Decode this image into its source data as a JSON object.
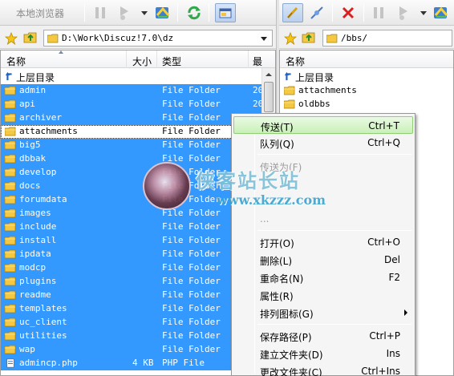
{
  "left_toolbar": {
    "local_browser_label": "本地浏览器"
  },
  "left_path": "D:\\Work\\Discuz!7.0\\dz",
  "right_path": "/bbs/",
  "columns": {
    "name": "名称",
    "size": "大小",
    "type": "类型",
    "date": "最"
  },
  "up_dir_label": "上层目录",
  "left_files": [
    {
      "name": "admin",
      "size": "",
      "type": "File Folder",
      "date": "20",
      "selected": true,
      "kind": "folder"
    },
    {
      "name": "api",
      "size": "",
      "type": "File Folder",
      "date": "20",
      "selected": true,
      "kind": "folder"
    },
    {
      "name": "archiver",
      "size": "",
      "type": "File Folder",
      "date": "",
      "selected": true,
      "kind": "folder"
    },
    {
      "name": "attachments",
      "size": "",
      "type": "File Folder",
      "date": "",
      "selected": false,
      "kind": "folder"
    },
    {
      "name": "big5",
      "size": "",
      "type": "File Folder",
      "date": "",
      "selected": true,
      "kind": "folder"
    },
    {
      "name": "dbbak",
      "size": "",
      "type": "File Folder",
      "date": "",
      "selected": true,
      "kind": "folder"
    },
    {
      "name": "develop",
      "size": "",
      "type": "File Folder",
      "date": "",
      "selected": true,
      "kind": "folder"
    },
    {
      "name": "docs",
      "size": "",
      "type": "File Folder",
      "date": "",
      "selected": true,
      "kind": "folder"
    },
    {
      "name": "forumdata",
      "size": "",
      "type": "File Folder",
      "date": "",
      "selected": true,
      "kind": "folder"
    },
    {
      "name": "images",
      "size": "",
      "type": "File Folder",
      "date": "",
      "selected": true,
      "kind": "folder"
    },
    {
      "name": "include",
      "size": "",
      "type": "File Folder",
      "date": "",
      "selected": true,
      "kind": "folder"
    },
    {
      "name": "install",
      "size": "",
      "type": "File Folder",
      "date": "",
      "selected": true,
      "kind": "folder"
    },
    {
      "name": "ipdata",
      "size": "",
      "type": "File Folder",
      "date": "",
      "selected": true,
      "kind": "folder"
    },
    {
      "name": "modcp",
      "size": "",
      "type": "File Folder",
      "date": "",
      "selected": true,
      "kind": "folder"
    },
    {
      "name": "plugins",
      "size": "",
      "type": "File Folder",
      "date": "",
      "selected": true,
      "kind": "folder"
    },
    {
      "name": "readme",
      "size": "",
      "type": "File Folder",
      "date": "",
      "selected": true,
      "kind": "folder"
    },
    {
      "name": "templates",
      "size": "",
      "type": "File Folder",
      "date": "",
      "selected": true,
      "kind": "folder"
    },
    {
      "name": "uc_client",
      "size": "",
      "type": "File Folder",
      "date": "",
      "selected": true,
      "kind": "folder"
    },
    {
      "name": "utilities",
      "size": "",
      "type": "File Folder",
      "date": "",
      "selected": true,
      "kind": "folder"
    },
    {
      "name": "wap",
      "size": "",
      "type": "File Folder",
      "date": "",
      "selected": true,
      "kind": "folder"
    },
    {
      "name": "admincp.php",
      "size": "4 KB",
      "type": "PHP File",
      "date": "",
      "selected": true,
      "kind": "file"
    }
  ],
  "right_files": [
    {
      "name": "attachments",
      "kind": "folder"
    },
    {
      "name": "oldbbs",
      "kind": "folder"
    }
  ],
  "context_menu": [
    {
      "label": "传送(T)",
      "shortcut": "Ctrl+T",
      "state": "highlighted"
    },
    {
      "label": "队列(Q)",
      "shortcut": "Ctrl+Q",
      "state": "normal"
    },
    {
      "sep": true
    },
    {
      "label": "传送为(F)",
      "shortcut": "",
      "state": "disabled"
    },
    {
      "label": "",
      "shortcut": "",
      "state": "obscured"
    },
    {
      "label": "",
      "shortcut": "",
      "state": "obscured"
    },
    {
      "label": "...",
      "shortcut": "",
      "state": "obscured"
    },
    {
      "sep": true
    },
    {
      "label": "打开(O)",
      "shortcut": "Ctrl+O",
      "state": "normal"
    },
    {
      "label": "删除(L)",
      "shortcut": "Del",
      "state": "normal"
    },
    {
      "label": "重命名(N)",
      "shortcut": "F2",
      "state": "normal"
    },
    {
      "label": "属性(R)",
      "shortcut": "",
      "state": "normal"
    },
    {
      "label": "排列图标(G)",
      "shortcut": "",
      "state": "normal",
      "submenu": true
    },
    {
      "sep": true
    },
    {
      "label": "保存路径(P)",
      "shortcut": "Ctrl+P",
      "state": "normal"
    },
    {
      "label": "建立文件夹(D)",
      "shortcut": "Ins",
      "state": "normal"
    },
    {
      "label": "更改文件夹(C)",
      "shortcut": "Ctrl+Ins",
      "state": "normal"
    }
  ],
  "watermark": {
    "title": "侠客站长站",
    "url": "www.xkzzz.com"
  },
  "colors": {
    "selection": "#3399ff",
    "menu_highlight": "#c9f0b8",
    "folder": "#f5c842"
  }
}
